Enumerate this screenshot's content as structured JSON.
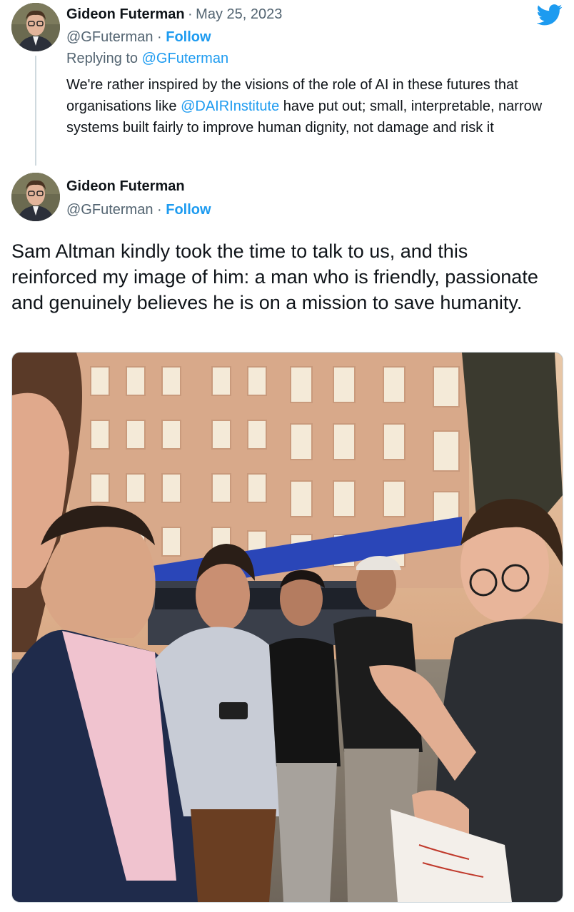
{
  "brand": {
    "icon": "twitter-bird-icon",
    "color": "#1d9bf0"
  },
  "reply_tweet": {
    "author_name": "Gideon Futerman",
    "separator": "·",
    "date": "May 25, 2023",
    "handle": "@GFuterman",
    "follow_label": "Follow",
    "replying_to_prefix": "Replying to ",
    "replying_to_handle": "@GFuterman",
    "text_before_mention": "We're rather inspired by the visions of the role of AI in these futures that organisations like ",
    "mention": "@DAIRInstitute",
    "text_after_mention": " have put out; small, interpretable, narrow systems built fairly to improve human dignity, not damage and risk it"
  },
  "main_tweet": {
    "author_name": "Gideon Futerman",
    "handle": "@GFuterman",
    "separator": "·",
    "follow_label": "Follow",
    "text": "Sam Altman kindly took the time to talk to us, and this reinforced my image of him: a man who is friendly, passionate and genuinely believes he is on a mission to save humanity."
  }
}
